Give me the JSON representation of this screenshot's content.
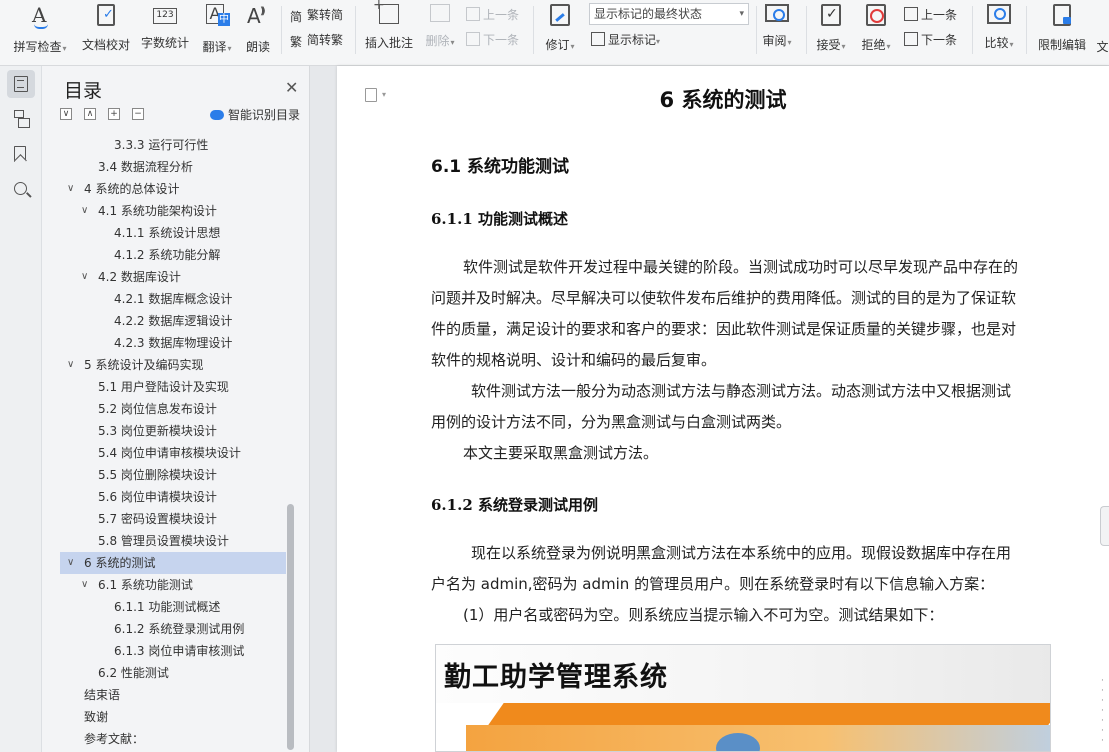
{
  "ribbon": {
    "spell_check": "拼写检查",
    "doc_proof": "文档校对",
    "word_count": "字数统计",
    "word_count_icon_text": "123",
    "translate": "翻译",
    "read_aloud": "朗读",
    "trad_to_simp": "繁转简",
    "simp_to_trad": "简转繁",
    "insert_comment": "插入批注",
    "delete": "删除",
    "prev_comment": "上一条",
    "next_comment": "下一条",
    "revise": "修订",
    "markup_state": "显示标记的最终状态",
    "show_markup": "显示标记",
    "review": "审阅",
    "accept": "接受",
    "reject": "拒绝",
    "prev_change": "上一条",
    "next_change": "下一条",
    "compare": "比较",
    "restrict_edit": "限制编辑",
    "more": "文"
  },
  "toc": {
    "title": "目录",
    "smart_toc": "智能识别目录",
    "items": [
      {
        "label": "3.3.3  运行可行性",
        "level": 3
      },
      {
        "label": "3.4 数据流程分析",
        "level": 2
      },
      {
        "label": "4   系统的总体设计",
        "level": 1,
        "arrow": "∨"
      },
      {
        "label": "4.1 系统功能架构设计",
        "level": 2,
        "arrow": "∨"
      },
      {
        "label": "4.1.1 系统设计思想",
        "level": 3
      },
      {
        "label": "4.1.2  系统功能分解",
        "level": 3
      },
      {
        "label": "4.2  数据库设计",
        "level": 2,
        "arrow": "∨"
      },
      {
        "label": "4.2.1  数据库概念设计",
        "level": 3
      },
      {
        "label": "4.2.2  数据库逻辑设计",
        "level": 3
      },
      {
        "label": "4.2.3  数据库物理设计",
        "level": 3
      },
      {
        "label": "5   系统设计及编码实现",
        "level": 1,
        "arrow": "∨"
      },
      {
        "label": "5.1 用户登陆设计及实现",
        "level": 2
      },
      {
        "label": "5.2  岗位信息发布设计",
        "level": 2
      },
      {
        "label": "5.3 岗位更新模块设计",
        "level": 2
      },
      {
        "label": "5.4  岗位申请审核模块设计",
        "level": 2
      },
      {
        "label": "5.5  岗位删除模块设计",
        "level": 2
      },
      {
        "label": "5.6  岗位申请模块设计",
        "level": 2
      },
      {
        "label": "5.7  密码设置模块设计",
        "level": 2
      },
      {
        "label": "5.8  管理员设置模块设计",
        "level": 2
      },
      {
        "label": "6  系统的测试",
        "level": 1,
        "arrow": "∨",
        "selected": true
      },
      {
        "label": "6.1 系统功能测试",
        "level": 2,
        "arrow": "∨"
      },
      {
        "label": "6.1.1  功能测试概述",
        "level": 3
      },
      {
        "label": "6.1.2  系统登录测试用例",
        "level": 3
      },
      {
        "label": "6.1.3  岗位申请审核测试",
        "level": 3
      },
      {
        "label": "6.2  性能测试",
        "level": 2
      },
      {
        "label": "结束语",
        "level": 1
      },
      {
        "label": "致谢",
        "level": 1
      },
      {
        "label": "参考文献：",
        "level": 1
      }
    ]
  },
  "document": {
    "chapter_title": "6  系统的测试",
    "section_title": "6.1 系统功能测试",
    "sub1_title": "6.1.1 功能测试概述",
    "para1": [
      "软件测试是软件开发过程中最关键的阶段。当测试成功时可以尽早发现产品中存在的",
      "问题并及时解决。尽早解决可以使软件发布后维护的费用降低。测试的目的是为了保证软",
      "件的质量，满足设计的要求和客户的要求：因此软件测试是保证质量的关键步骤，也是对",
      "软件的规格说明、设计和编码的最后复审。"
    ],
    "para2": [
      "软件测试方法一般分为动态测试方法与静态测试方法。动态测试方法中又根据测试",
      "用例的设计方法不同，分为黑盒测试与白盒测试两类。"
    ],
    "para3": "本文主要采取黑盒测试方法。",
    "sub2_title": "6.1.2 系统登录测试用例",
    "para4": [
      "现在以系统登录为例说明黑盒测试方法在本系统中的应用。现假设数据库中存在用",
      "户名为 admin,密码为 admin 的管理员用户。则在系统登录时有以下信息输入方案：",
      "(1）用户名或密码为空。则系统应当提示输入不可为空。测试结果如下："
    ],
    "figure_title": "勤工助学管理系统"
  }
}
